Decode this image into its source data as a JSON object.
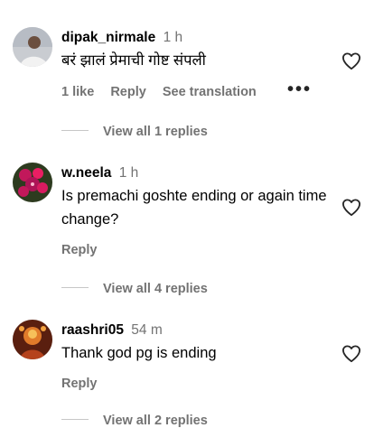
{
  "comments": [
    {
      "username": "dipak_nirmale",
      "time": "1 h",
      "text": "बरं झालं प्रेमाची गोष्ट संपली",
      "likes": "1 like",
      "reply_label": "Reply",
      "translation_label": "See translation",
      "more_icon": "more-horizontal-icon"
    },
    {
      "username": "w.neela",
      "time": "1 h",
      "text": "Is premachi goshte ending or again time change?",
      "reply_label": "Reply"
    },
    {
      "username": "raashri05",
      "time": "54 m",
      "text": "Thank god pg is ending",
      "reply_label": "Reply"
    }
  ],
  "replies": [
    {
      "label": "View all 1 replies"
    },
    {
      "label": "View all 4 replies"
    },
    {
      "label": "View all 2 replies"
    }
  ],
  "icons": {
    "like": "heart-outline-icon",
    "more": "more-horizontal-icon"
  },
  "colors": {
    "secondary_text": "#737373",
    "divider": "#c7c7c7"
  }
}
